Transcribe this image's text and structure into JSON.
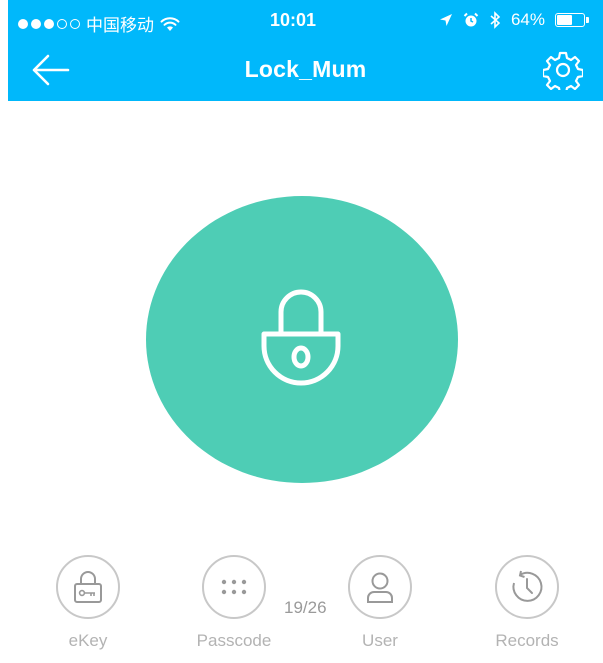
{
  "status_bar": {
    "carrier": "中国移动",
    "time": "10:01",
    "battery": "64%",
    "battery_level": 0.64,
    "signal_icon": "signal-dots-icon",
    "wifi_icon": "wifi-icon",
    "location_icon": "location-arrow-icon",
    "alarm_icon": "alarm-icon",
    "bluetooth_icon": "bluetooth-icon"
  },
  "nav": {
    "title": "Lock_Mum",
    "back_icon": "arrow-left-icon",
    "settings_icon": "gear-icon"
  },
  "lock": {
    "icon": "padlock-icon",
    "color": "#4ecdb5"
  },
  "colors": {
    "header": "#00b8fb",
    "toolbar_gray": "#b3b3b3"
  },
  "toolbar": {
    "counter": "19/26",
    "items": [
      {
        "label": "eKey",
        "icon": "ekey-icon"
      },
      {
        "label": "Passcode",
        "icon": "keypad-icon"
      },
      {
        "label": "User",
        "icon": "user-icon"
      },
      {
        "label": "Records",
        "icon": "history-clock-icon"
      }
    ]
  }
}
